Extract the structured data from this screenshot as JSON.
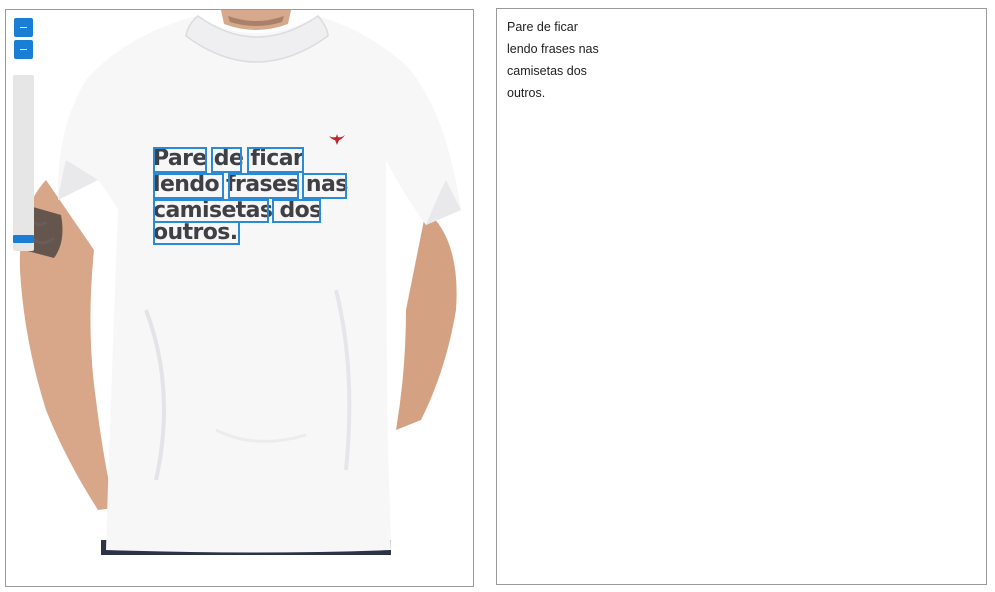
{
  "viewer": {
    "zoom_in_icon": "plus-icon",
    "zoom_out_icon": "minus-icon",
    "zoom_level": 0.05
  },
  "shirt_print": {
    "lines": [
      "Pare de ficar",
      "lendo frases nas",
      "camisetas dos",
      "outros."
    ],
    "logo": "bird-icon"
  },
  "ocr_result": {
    "lines": [
      "Pare de ficar",
      "lendo frases nas",
      "camisetas dos",
      "outros."
    ]
  },
  "colors": {
    "accent": "#1a7fd4",
    "box": "#2a8ad6",
    "print": "#3f3f46",
    "logo": "#c0262b"
  }
}
